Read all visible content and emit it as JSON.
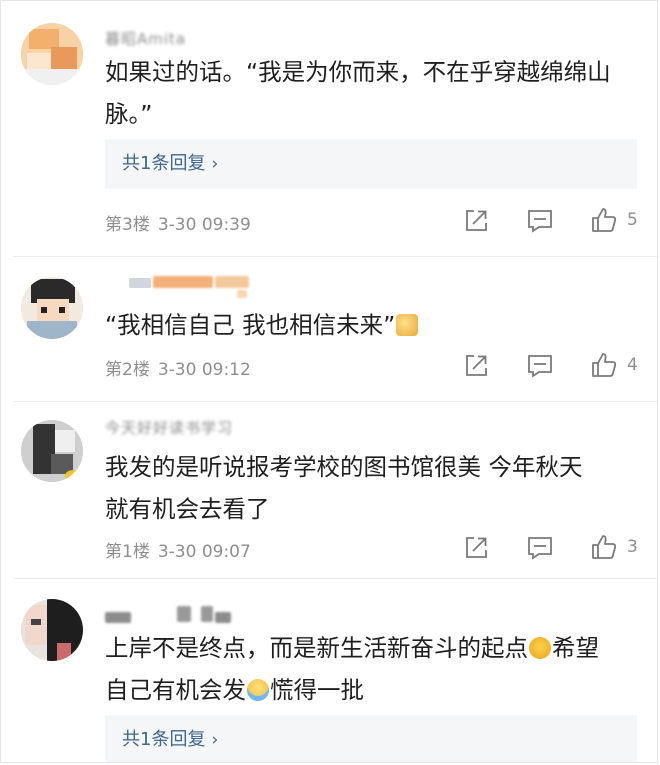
{
  "comments": [
    {
      "username": "暮昭Amita",
      "text_line1": "如果过的话。“我是为你而来，不在乎穿越绵绵山",
      "text_line2": "脉。”",
      "reply_label": "共1条回复",
      "floor": "第3楼",
      "datetime": "3-30 09:39",
      "likes": "5"
    },
    {
      "username": "",
      "text_line1": "“我相信自己 我也相信未来”",
      "emoji_after": "cheers-emoji",
      "floor": "第2楼",
      "datetime": "3-30 09:12",
      "likes": "4"
    },
    {
      "username": "今天好好读书学习",
      "text_line1": "我发的是听说报考学校的图书馆很美  今年秋天",
      "text_line2": "就有机会去看了",
      "floor": "第1楼",
      "datetime": "3-30 09:07",
      "likes": "3"
    },
    {
      "username": "",
      "text_line1a": "上岸不是终点，而是新生活新奋斗的起点",
      "emoji1": "cat-face-emoji",
      "text_line1b": "希望",
      "text_line2a": "自己有机会发",
      "emoji2": "laughing-emoji",
      "text_line2b": "慌得一批",
      "reply_label": "共1条回复"
    }
  ],
  "icons": {
    "share": "share-icon",
    "comment": "comment-icon",
    "like": "thumbs-up-icon",
    "reply_chevron": "chevron-right-icon"
  },
  "colors": {
    "link": "#3e6690",
    "meta": "#8e8e8e",
    "reply_bg": "#f4f6f8"
  }
}
